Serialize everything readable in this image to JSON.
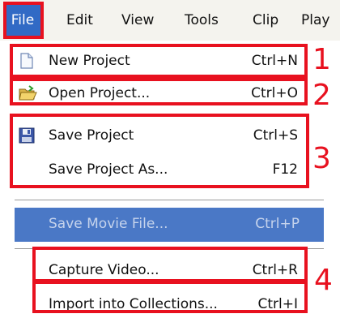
{
  "menubar": {
    "items": [
      "File",
      "Edit",
      "View",
      "Tools",
      "Clip",
      "Play"
    ],
    "active": "File"
  },
  "menu": {
    "new_project": {
      "label": "New Project",
      "shortcut": "Ctrl+N",
      "icon": "new-document-icon"
    },
    "open_project": {
      "label": "Open Project...",
      "shortcut": "Ctrl+O",
      "icon": "open-folder-icon"
    },
    "save_project": {
      "label": "Save Project",
      "shortcut": "Ctrl+S",
      "icon": "floppy-disk-icon"
    },
    "save_project_as": {
      "label": "Save Project As...",
      "shortcut": "F12"
    },
    "save_movie_file": {
      "label": "Save Movie File...",
      "shortcut": "Ctrl+P",
      "disabled": true
    },
    "capture_video": {
      "label": "Capture Video...",
      "shortcut": "Ctrl+R"
    },
    "import_collections": {
      "label": "Import into Collections...",
      "shortcut": "Ctrl+I"
    }
  },
  "annotations": {
    "n1": "1",
    "n2": "2",
    "n3": "3",
    "n4": "4"
  },
  "colors": {
    "annotation_red": "#e8111f",
    "highlight_blue": "#4a78c6",
    "active_menu_blue": "#316ac5"
  }
}
